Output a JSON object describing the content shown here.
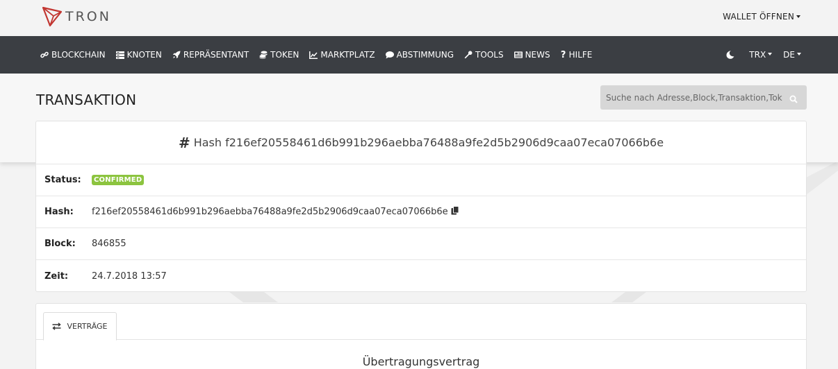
{
  "brand": {
    "name": "TRON"
  },
  "header": {
    "wallet_label": "WALLET ÖFFNEN"
  },
  "nav": {
    "items": [
      {
        "label": "BLOCKCHAIN",
        "icon": "link-icon"
      },
      {
        "label": "KNOTEN",
        "icon": "server-icon"
      },
      {
        "label": "REPRÄSENTANT",
        "icon": "rocket-icon"
      },
      {
        "label": "TOKEN",
        "icon": "coins-icon"
      },
      {
        "label": "MARKTPLATZ",
        "icon": "chart-line-icon"
      },
      {
        "label": "ABSTIMMUNG",
        "icon": "comment-icon"
      },
      {
        "label": "TOOLS",
        "icon": "wrench-icon"
      },
      {
        "label": "NEWS",
        "icon": "newspaper-icon"
      },
      {
        "label": "HILFE",
        "icon": "question-icon"
      }
    ],
    "currency": "TRX",
    "language": "DE"
  },
  "page": {
    "title": "TRANSAKTION",
    "search_placeholder": "Suche nach Adresse,Block,Transaktion,Token"
  },
  "transaction": {
    "hash_heading": "Hash f216ef20558461d6b991b296aebba76488a9fe2d5b2906d9caa07eca07066b6e",
    "fields": [
      {
        "label": "Status:",
        "value": "CONFIRMED"
      },
      {
        "label": "Hash:",
        "value": "f216ef20558461d6b991b296aebba76488a9fe2d5b2906d9caa07eca07066b6e"
      },
      {
        "label": "Block:",
        "value": "846855"
      },
      {
        "label": "Zeit:",
        "value": "24.7.2018 13:57"
      }
    ]
  },
  "contracts": {
    "tab_label": "VERTRÄGE",
    "section_title": "Übertragungsvertrag"
  },
  "colors": {
    "navbar_bg": "#3b3e43",
    "brand_red": "#c23631",
    "badge_green": "#8cc43f"
  }
}
